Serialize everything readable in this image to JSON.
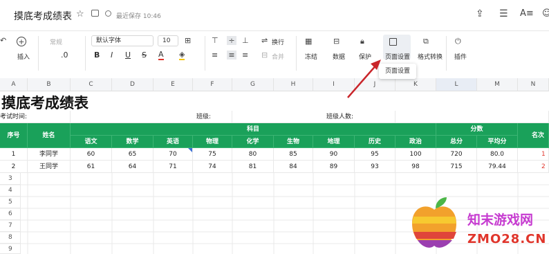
{
  "header": {
    "doc_title": "摸底考成绩表",
    "saved_status": "最近保存 10:46"
  },
  "toolbar": {
    "insert_label": "插入",
    "format_select": "常规",
    "decimal_label": ".0",
    "font_select": "默认字体",
    "font_size_select": "10",
    "wrap_label": "换行",
    "merge_label": "合并",
    "freeze_label": "冻结",
    "data_label": "数据",
    "protect_label": "保护",
    "page_setup_label": "页面设置",
    "format_convert_label": "格式转换",
    "plugin_label": "插件",
    "bold": "B",
    "italic": "I",
    "underline": "U",
    "strike": "S",
    "font_color": "A"
  },
  "tooltip": {
    "page_setup": "页面设置"
  },
  "columns": [
    "A",
    "B",
    "C",
    "D",
    "E",
    "F",
    "G",
    "H",
    "I",
    "J",
    "K",
    "L",
    "M",
    "N"
  ],
  "sheet": {
    "title": "摸底考成绩表",
    "exam_time_label": "考试时间:",
    "class_label": "班级:",
    "class_count_label": "班级人数:",
    "header_seq": "序号",
    "header_name": "姓名",
    "header_subjects": "科目",
    "header_scores": "分数",
    "header_rank": "名次",
    "subjects": [
      "语文",
      "数学",
      "英语",
      "物理",
      "化学",
      "生物",
      "地理",
      "历史",
      "政治"
    ],
    "score_cols": [
      "总分",
      "平均分"
    ],
    "rows": [
      {
        "seq": "1",
        "name": "李同学",
        "scores": [
          "60",
          "65",
          "70",
          "75",
          "80",
          "85",
          "90",
          "95",
          "100"
        ],
        "total": "720",
        "avg": "80.0",
        "rank": "1"
      },
      {
        "seq": "2",
        "name": "王同学",
        "scores": [
          "61",
          "64",
          "71",
          "74",
          "81",
          "84",
          "89",
          "93",
          "98"
        ],
        "total": "715",
        "avg": "79.44",
        "rank": "2"
      }
    ],
    "row_numbers": [
      "3",
      "4",
      "5",
      "6",
      "7",
      "8",
      "9"
    ]
  },
  "watermark": {
    "brand": "知末游戏网",
    "domain": "ZMO28.CN"
  },
  "colors": {
    "green": "#1aa15a",
    "rank_red": "#e0352b",
    "arrow": "#c9252a"
  }
}
